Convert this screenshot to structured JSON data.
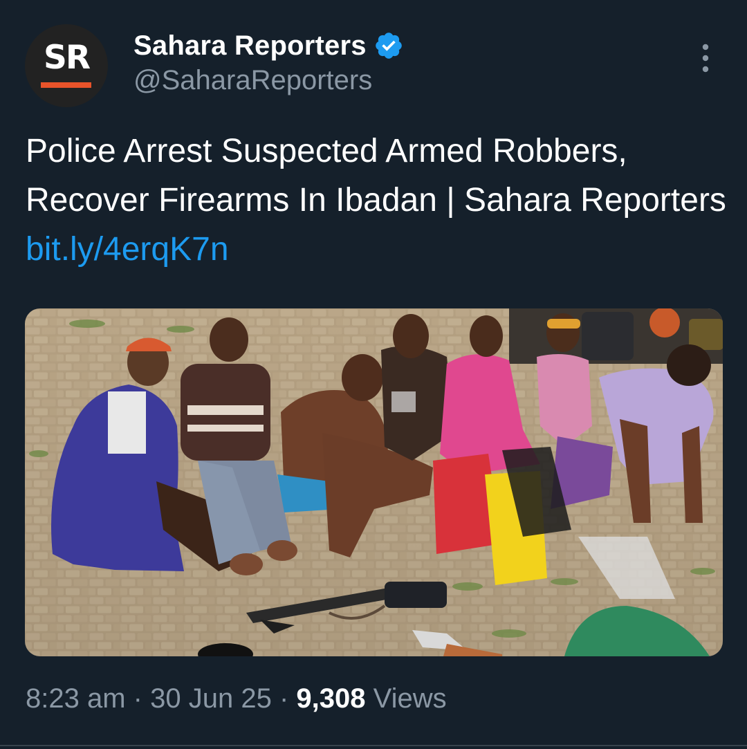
{
  "author": {
    "avatar_text": "SR",
    "name": "Sahara Reporters",
    "handle": "@SaharaReporters",
    "verified": true
  },
  "tweet": {
    "text": "Police Arrest Suspected Armed Robbers, Recover Firearms In Ibadan | Sahara Reporters",
    "link": "bit.ly/4erqK7n",
    "image_description": "photo"
  },
  "meta": {
    "time": "8:23 am",
    "separator": "·",
    "date": "30 Jun 25",
    "views_count": "9,308",
    "views_label": "Views"
  },
  "colors": {
    "background": "#15202b",
    "link": "#1d9bf0",
    "secondary_text": "#8b98a5",
    "verified_badge": "#1d9bf0",
    "brand_accent": "#e8532a"
  },
  "icons": {
    "verified": "verified-badge-icon",
    "more": "more-vertical-icon"
  }
}
